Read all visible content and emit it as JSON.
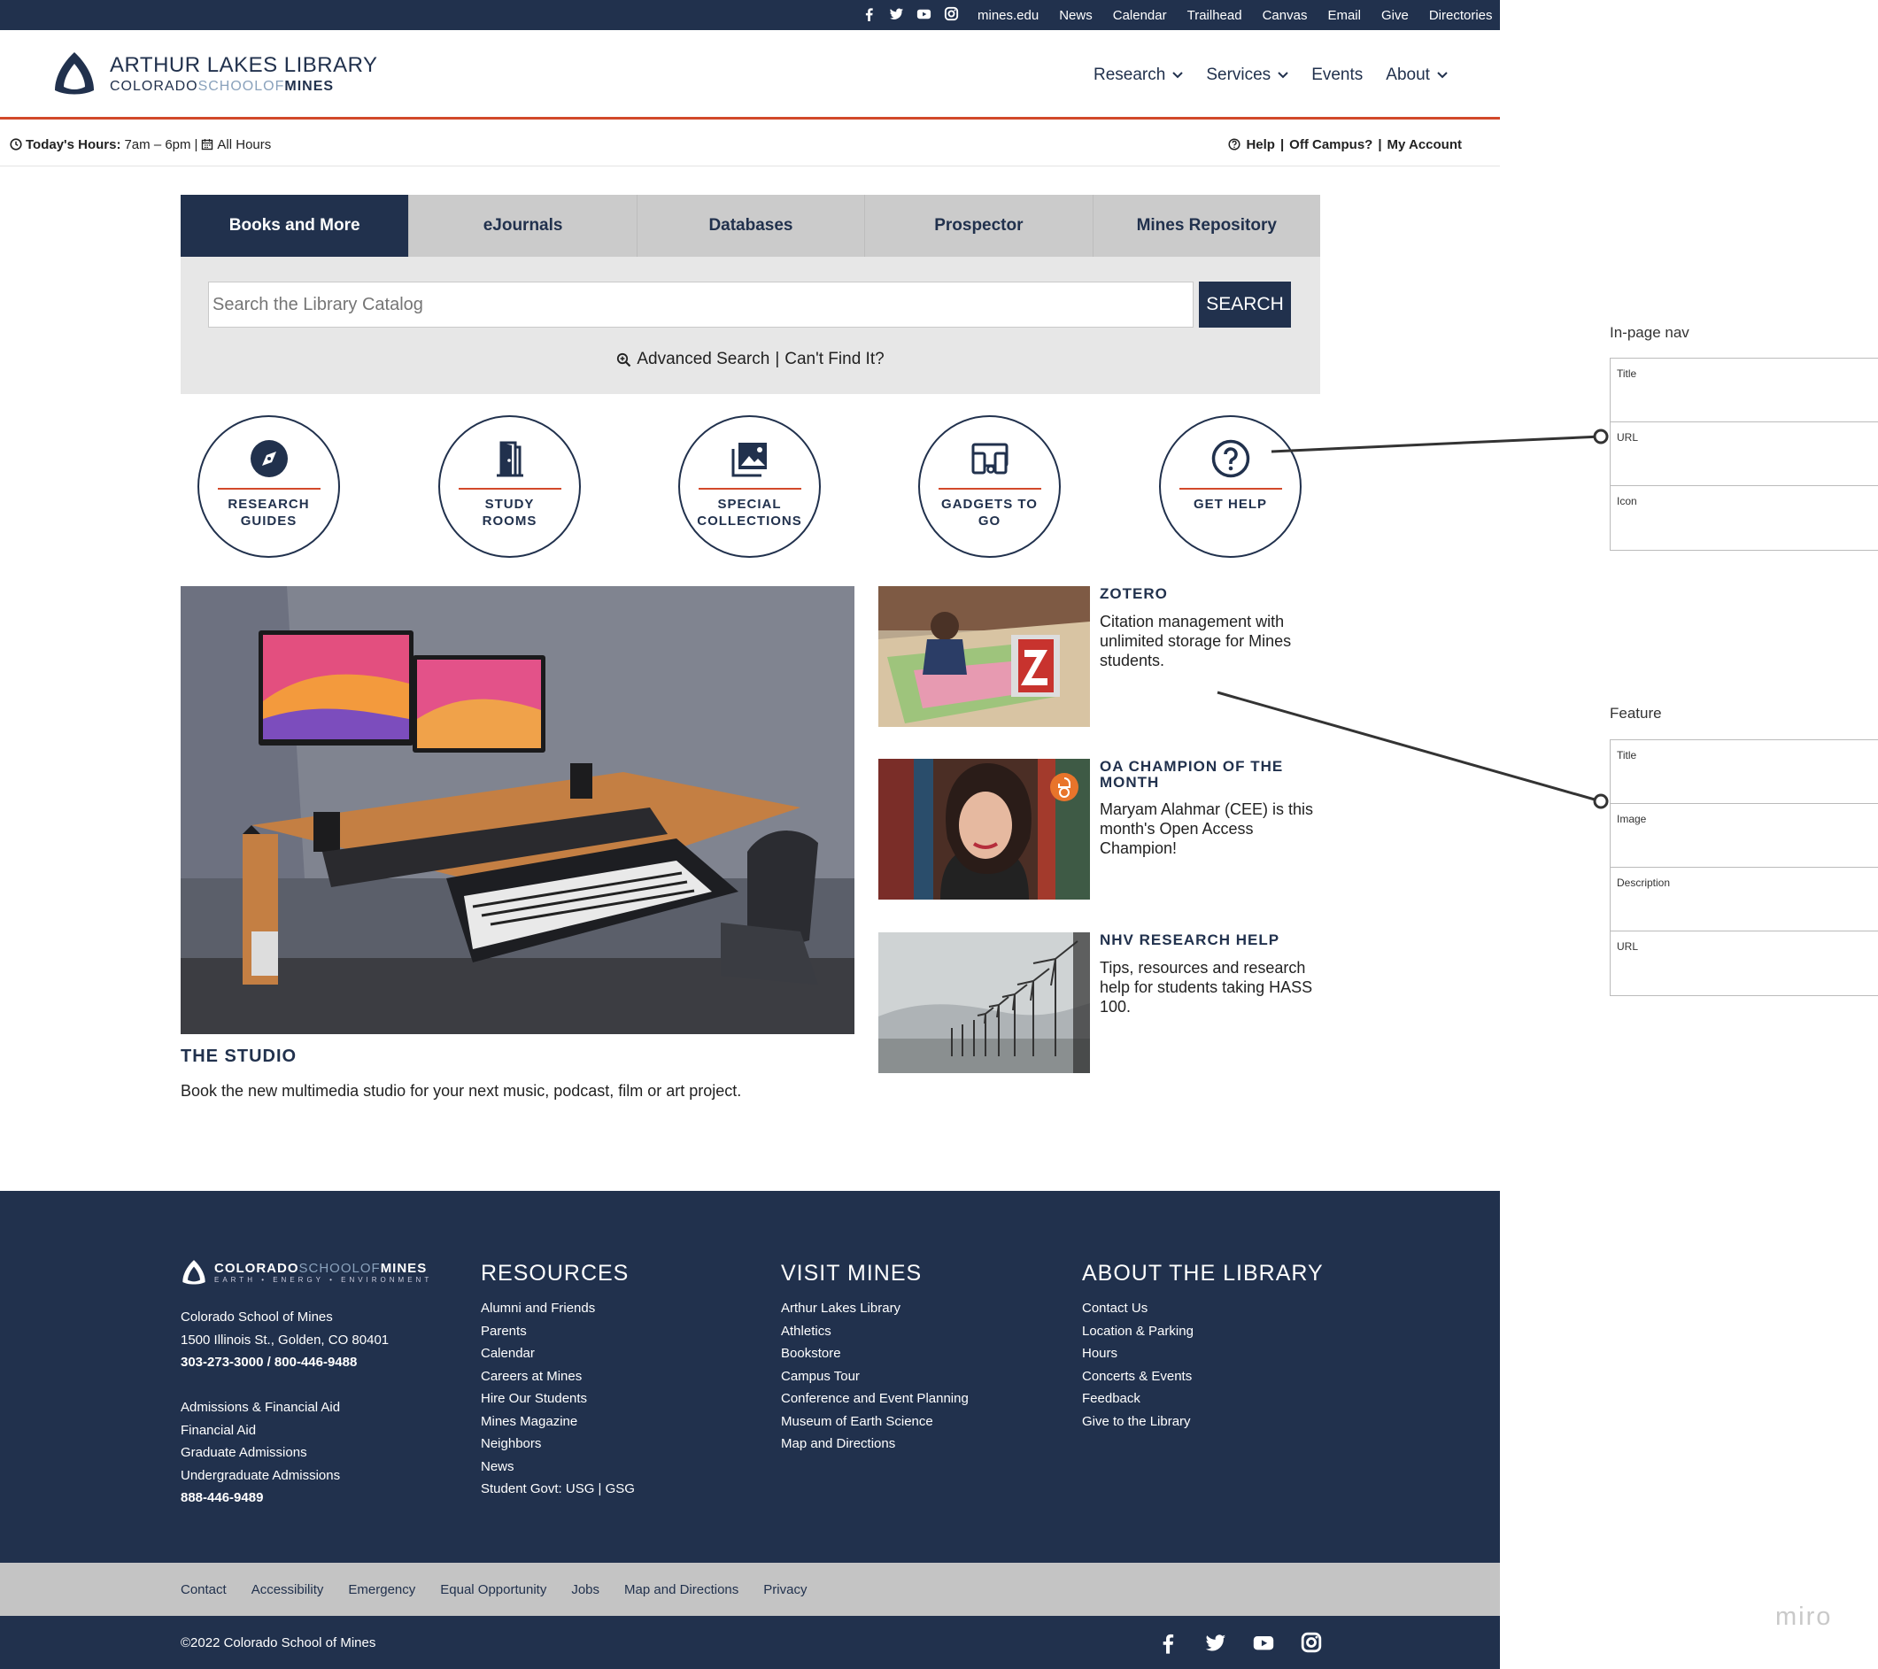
{
  "topbar": {
    "social_icons": [
      "facebook-icon",
      "twitter-icon",
      "youtube-icon",
      "instagram-icon"
    ],
    "links": [
      "mines.edu",
      "News",
      "Calendar",
      "Trailhead",
      "Canvas",
      "Email",
      "Give",
      "Directories"
    ]
  },
  "header": {
    "logo_line1": "ARTHUR LAKES LIBRARY",
    "logo_line2a": "COLORADO",
    "logo_line2b": "SCHOOLOF",
    "logo_line2c": "MINES",
    "nav": [
      "Research",
      "Services",
      "Events",
      "About"
    ]
  },
  "hours": {
    "label": "Today's Hours:",
    "value": "7am – 6pm",
    "sep": "|",
    "all": "All Hours",
    "help": "Help",
    "off": "Off Campus?",
    "account": "My Account"
  },
  "search": {
    "tabs": [
      "Books and More",
      "eJournals",
      "Databases",
      "Prospector",
      "Mines Repository"
    ],
    "placeholder": "Search the Library Catalog",
    "button": "SEARCH",
    "advanced": "Advanced Search",
    "sep": "|",
    "cantfind": "Can't Find It?"
  },
  "quicklinks": [
    {
      "label": "RESEARCH GUIDES",
      "icon": "compass-icon"
    },
    {
      "label": "STUDY ROOMS",
      "icon": "door-icon"
    },
    {
      "label": "SPECIAL COLLECTIONS",
      "icon": "images-icon"
    },
    {
      "label": "GADGETS TO GO",
      "icon": "devices-icon"
    },
    {
      "label": "GET HELP",
      "icon": "question-icon"
    }
  ],
  "studio": {
    "title": "THE STUDIO",
    "description": "Book the new multimedia studio for your next music, podcast, film or art project."
  },
  "features": [
    {
      "title": "ZOTERO",
      "description": "Citation management with unlimited storage for Mines students."
    },
    {
      "title": "OA CHAMPION OF THE MONTH",
      "description": "Maryam Alahmar (CEE) is this month's Open Access Champion!"
    },
    {
      "title": "NHV RESEARCH HELP",
      "description": "Tips, resources and research help for students taking HASS 100."
    }
  ],
  "footer": {
    "logo_a": "COLORADO",
    "logo_b": "SCHOOLOF",
    "logo_c": "MINES",
    "logo_tag": "EARTH • ENERGY • ENVIRONMENT",
    "address": [
      "Colorado School of Mines",
      "1500 Illinois St., Golden, CO 80401"
    ],
    "phone": "303-273-3000 / 800-446-9488",
    "admissions": [
      "Admissions & Financial Aid",
      "Financial Aid",
      "Graduate Admissions",
      "Undergraduate Admissions"
    ],
    "admissions_phone": "888-446-9489",
    "resources_title": "RESOURCES",
    "resources": [
      "Alumni and Friends",
      "Parents",
      "Calendar",
      "Careers at Mines",
      "Hire Our Students",
      "Mines Magazine",
      "Neighbors",
      "News",
      "Student Govt: USG | GSG"
    ],
    "visit_title": "VISIT MINES",
    "visit": [
      "Arthur Lakes Library",
      "Athletics",
      "Bookstore",
      "Campus Tour",
      "Conference and Event Planning",
      "Museum of Earth Science",
      "Map and Directions"
    ],
    "about_title": "ABOUT THE LIBRARY",
    "about": [
      "Contact Us",
      "Location & Parking",
      "Hours",
      "Concerts & Events",
      "Feedback",
      "Give to the Library"
    ],
    "sub_links": [
      "Contact",
      "Accessibility",
      "Emergency",
      "Equal Opportunity",
      "Jobs",
      "Map and Directions",
      "Privacy"
    ],
    "copyright": "©2022 Colorado School of Mines"
  },
  "annotations": {
    "inpage_title": "In-page nav",
    "inpage_rows": [
      "Title",
      "URL",
      "Icon"
    ],
    "feature_title": "Feature",
    "feature_rows": [
      "Title",
      "Image",
      "Description",
      "URL"
    ],
    "watermark": "miro"
  },
  "colors": {
    "navy": "#21314d",
    "accent": "#d2492a",
    "gray_panel": "#e7e7e7",
    "tab_gray": "#cbcbcb"
  }
}
